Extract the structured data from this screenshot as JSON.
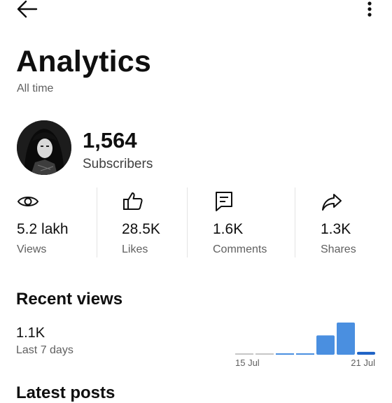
{
  "header": {
    "back_icon": "arrow-left-icon",
    "more_icon": "more-vertical-icon"
  },
  "page": {
    "title": "Analytics",
    "period": "All time"
  },
  "channel": {
    "subscriber_count": "1,564",
    "subscriber_label": "Subscribers"
  },
  "stats": [
    {
      "icon": "eye-icon",
      "value": "5.2 lakh",
      "label": "Views"
    },
    {
      "icon": "thumbs-up-icon",
      "value": "28.5K",
      "label": "Likes"
    },
    {
      "icon": "comment-icon",
      "value": "1.6K",
      "label": "Comments"
    },
    {
      "icon": "share-icon",
      "value": "1.3K",
      "label": "Shares"
    }
  ],
  "recent": {
    "title": "Recent views",
    "value": "1.1K",
    "label": "Last 7 days"
  },
  "chart_data": {
    "type": "bar",
    "categories": [
      "15 Jul",
      "16 Jul",
      "17 Jul",
      "18 Jul",
      "19 Jul",
      "20 Jul",
      "21 Jul"
    ],
    "values": [
      0,
      0,
      0.1,
      0.1,
      27,
      45,
      4
    ],
    "x_tick_labels": [
      "15 Jul",
      "21 Jul"
    ],
    "colors": {
      "muted": "#c6c6c6",
      "active": "#4a8fe0",
      "current": "#1f63c6"
    },
    "grid": false
  },
  "next_section": {
    "title": "Latest posts"
  }
}
